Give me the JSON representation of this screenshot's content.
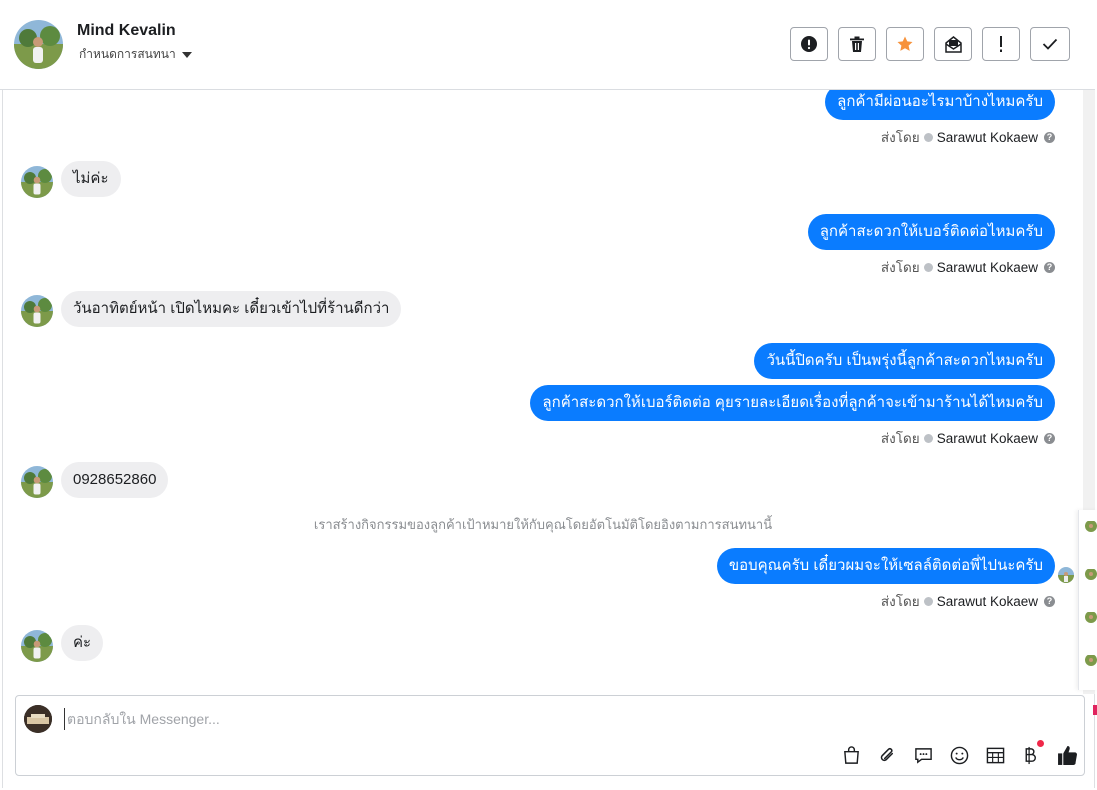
{
  "header": {
    "contact_name": "Mind Kevalin",
    "assign_label": "กำหนดการสนทนา",
    "actions": [
      {
        "name": "spam",
        "icon": "alert-circle-icon"
      },
      {
        "name": "delete",
        "icon": "trash-icon"
      },
      {
        "name": "star",
        "icon": "star-icon",
        "color": "#f7923b"
      },
      {
        "name": "mark-unread",
        "icon": "envelope-icon"
      },
      {
        "name": "follow-up",
        "icon": "exclamation-icon"
      },
      {
        "name": "done",
        "icon": "check-icon"
      }
    ]
  },
  "messages": [
    {
      "dir": "out",
      "text": "ลูกค้ามีผ่อนอะไรมาบ้างไหมครับ"
    },
    {
      "dir": "in",
      "text": "ไม่ค่ะ"
    },
    {
      "dir": "out",
      "text": "ลูกค้าสะดวกให้เบอร์ติดต่อไหมครับ"
    },
    {
      "dir": "in",
      "text": "วันอาทิตย์หน้า เปิดไหมคะ เดี๋ยวเข้าไปที่ร้านดีกว่า"
    },
    {
      "dir": "out",
      "text": "วันนี้ปิดครับ เป็นพรุ่งนี้ลูกค้าสะดวกไหมครับ"
    },
    {
      "dir": "out",
      "text": "ลูกค้าสะดวกให้เบอร์ติดต่อ คุยรายละเอียดเรื่องที่ลูกค้าจะเข้ามาร้านได้ไหมครับ"
    },
    {
      "dir": "in",
      "text": "0928652860"
    },
    {
      "dir": "out",
      "text": "ขอบคุณครับ เดี๋ยวผมจะให้เซลล์ติดต่อพี่ไปนะครับ"
    },
    {
      "dir": "in",
      "text": "ค่ะ"
    }
  ],
  "sent_by": {
    "prefix": "ส่งโดย",
    "agent": "Sarawut Kokaew"
  },
  "system_note": "เราสร้างกิจกรรมของลูกค้าเป้าหมายให้กับคุณโดยอัตโนมัติโดยอิงตามการสนทนานี้",
  "composer": {
    "placeholder": "ตอบกลับใน Messenger...",
    "value": "",
    "tools": [
      "shopping-bag-icon",
      "paperclip-icon",
      "saved-reply-icon",
      "emoji-icon",
      "table-icon",
      "baht-icon",
      "thumbs-up-icon"
    ]
  },
  "colors": {
    "accent": "#0a7cff",
    "incoming_bubble": "#eeeef0",
    "notification": "#f02849"
  }
}
